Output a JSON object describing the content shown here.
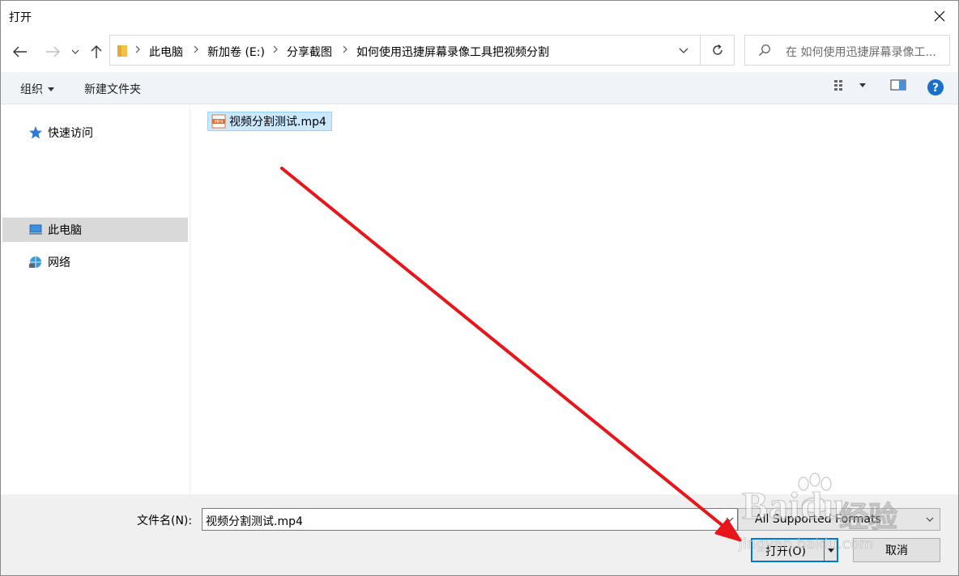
{
  "window": {
    "title": "打开"
  },
  "address": {
    "breadcrumbs": [
      "此电脑",
      "新加卷 (E:)",
      "分享截图",
      "如何使用迅捷屏幕录像工具把视频分割"
    ]
  },
  "search": {
    "placeholder": "在 如何使用迅捷屏幕录像工..."
  },
  "toolbar": {
    "organize_label": "组织",
    "new_folder_label": "新建文件夹"
  },
  "sidebar": {
    "items": [
      {
        "label": "快速访问",
        "icon": "star-icon"
      },
      {
        "label": "此电脑",
        "icon": "computer-icon",
        "selected": true
      },
      {
        "label": "网络",
        "icon": "network-icon"
      }
    ]
  },
  "files": [
    {
      "name": "视频分割测试.mp4",
      "icon": "mp4-file-icon",
      "selected": true
    }
  ],
  "footer": {
    "filename_label": "文件名(N):",
    "filename_value": "视频分割测试.mp4",
    "filetype_value": "All Supported Formats",
    "open_label": "打开(O)",
    "cancel_label": "取消"
  },
  "watermark": {
    "brand": "Baidu",
    "cn": "经验",
    "url": "jingyan.baidu.com"
  },
  "colors": {
    "accent": "#0078d7",
    "selection": "#cce8ff",
    "annotation_arrow": "#e8161b"
  }
}
